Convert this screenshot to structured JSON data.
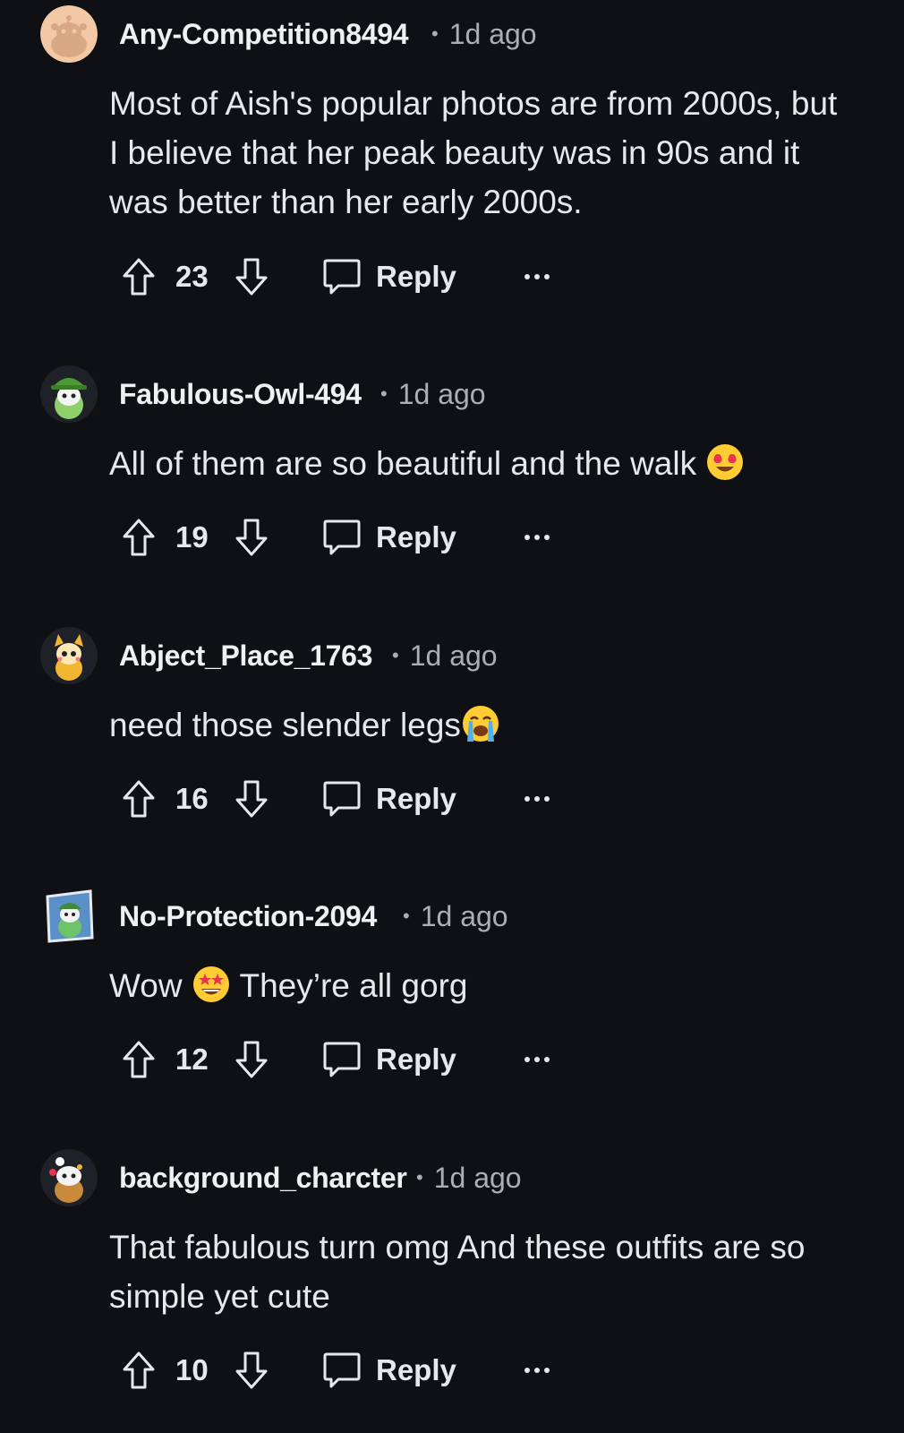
{
  "comments": [
    {
      "username": "Any-Competition8494",
      "time": "1d ago",
      "text": "Most of Aish's popular photos are from 2000s, but I believe that her peak beauty was in 90s and it was better than her early 2000s.",
      "score": "23",
      "reply_label": "Reply",
      "avatar": "default-orange-snoo-avatar"
    },
    {
      "username": "Fabulous-Owl-494",
      "time": "1d ago",
      "text": "All of them are so beautiful and the walk",
      "emoji": "heart-eyes-emoji",
      "score": "19",
      "reply_label": "Reply",
      "avatar": "green-hat-snoo-avatar"
    },
    {
      "username": "Abject_Place_1763",
      "time": "1d ago",
      "text": "need those slender legs",
      "emoji": "loudly-crying-emoji",
      "score": "16",
      "reply_label": "Reply",
      "avatar": "yellow-costume-snoo-avatar"
    },
    {
      "username": "No-Protection-2094",
      "time": "1d ago",
      "text_before": "Wow",
      "emoji": "star-struck-emoji",
      "text_after": "They’re all gorg",
      "score": "12",
      "reply_label": "Reply",
      "avatar": "blue-scene-snoo-avatar"
    },
    {
      "username": "background_charcter",
      "time": "1d ago",
      "text": "That fabulous turn omg And these outfits are so simple yet cute",
      "score": "10",
      "reply_label": "Reply",
      "avatar": "brown-snoo-avatar"
    }
  ],
  "meta_separator": "•",
  "icons": {
    "upvote": "upvote-arrow-icon",
    "downvote": "downvote-arrow-icon",
    "reply": "speech-bubble-icon",
    "more": "more-dots-icon"
  },
  "colors": {
    "background": "#0e1013",
    "text": "#e6e8eb",
    "meta": "#a9afb5"
  }
}
